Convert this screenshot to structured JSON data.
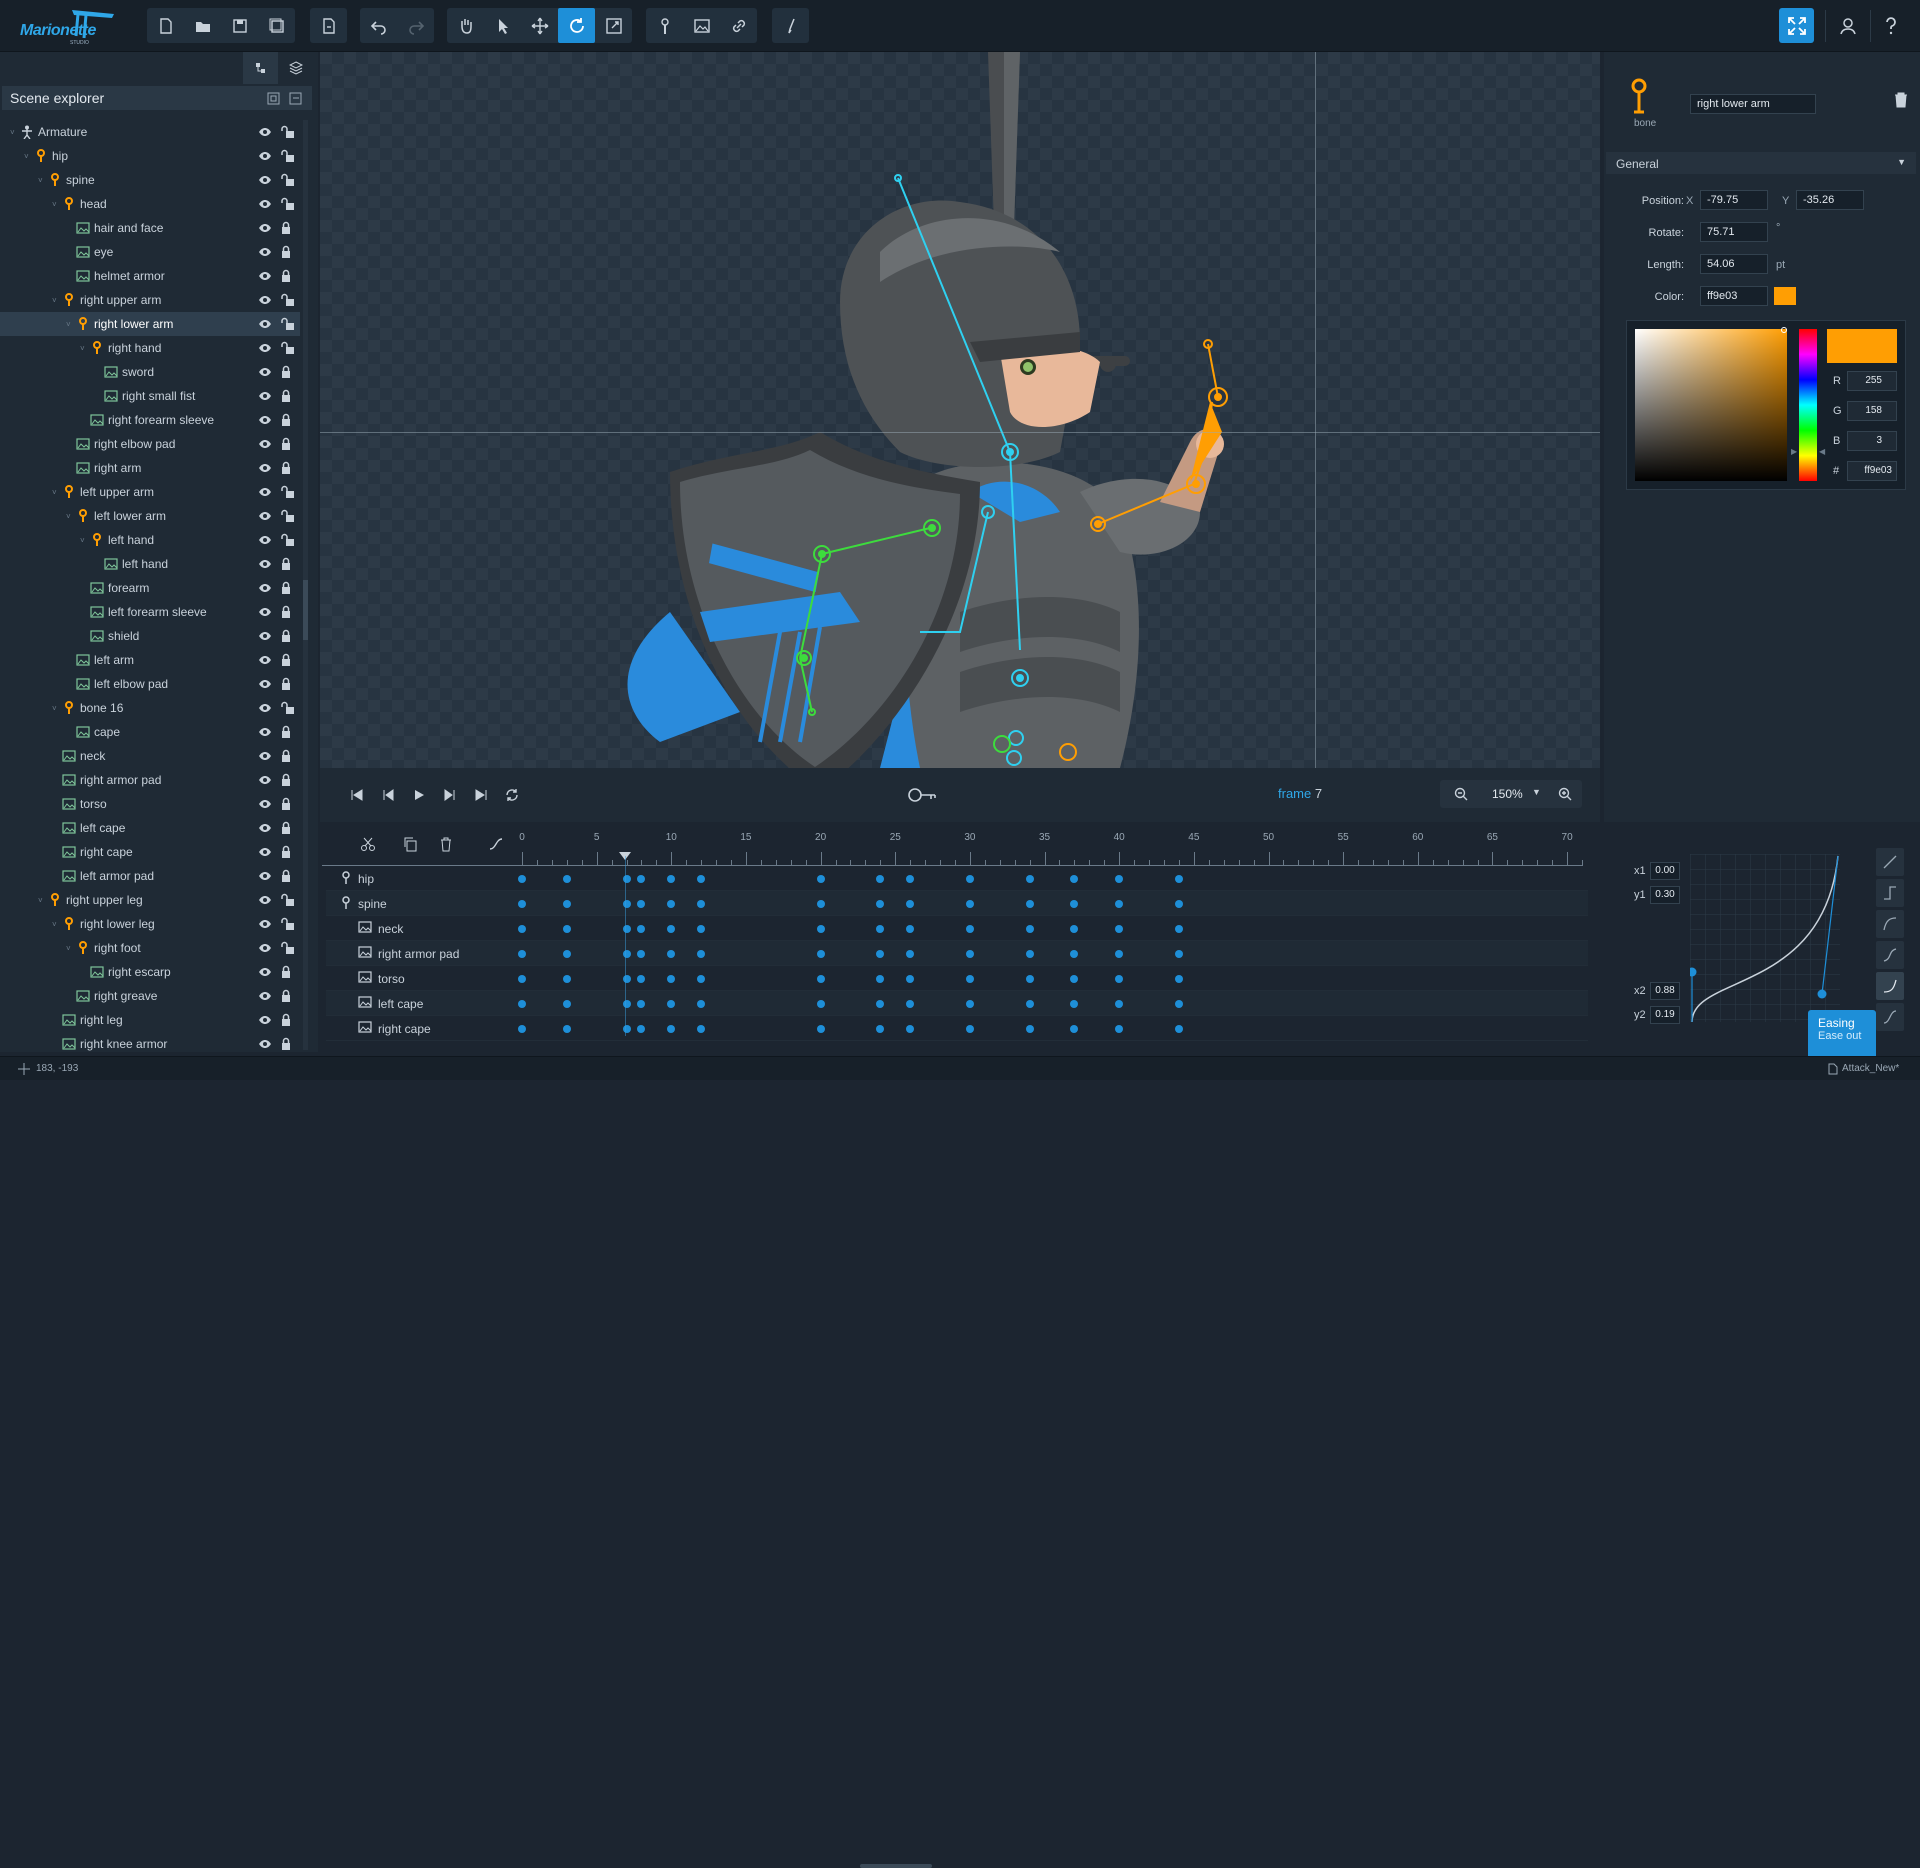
{
  "app": {
    "logo_text": "Marionette",
    "logo_sub": "STUDIO"
  },
  "toolbar": {
    "file_tools": [
      "new-file",
      "open-folder",
      "save",
      "save-all"
    ],
    "export_tool": "export",
    "history_tools": [
      "undo",
      "redo"
    ],
    "transform_tools": [
      "pan-hand",
      "select-arrow",
      "move",
      "rotate",
      "scale"
    ],
    "active_tool": "rotate",
    "create_tools": [
      "add-bone",
      "add-image",
      "link"
    ],
    "extra_tool": "pen"
  },
  "left_panel": {
    "title": "Scene explorer",
    "tree": [
      {
        "label": "Armature",
        "type": "armature",
        "depth": 0,
        "caret": true
      },
      {
        "label": "hip",
        "type": "bone",
        "depth": 1,
        "caret": true
      },
      {
        "label": "spine",
        "type": "bone",
        "depth": 2,
        "caret": true
      },
      {
        "label": "head",
        "type": "bone",
        "depth": 3,
        "caret": true
      },
      {
        "label": "hair and face",
        "type": "image",
        "depth": 4
      },
      {
        "label": "eye",
        "type": "image",
        "depth": 4
      },
      {
        "label": "helmet armor",
        "type": "image",
        "depth": 4
      },
      {
        "label": "right upper arm",
        "type": "bone",
        "depth": 3,
        "caret": true
      },
      {
        "label": "right lower arm",
        "type": "bone",
        "depth": 4,
        "caret": true,
        "selected": true
      },
      {
        "label": "right hand",
        "type": "bone",
        "depth": 5,
        "caret": true
      },
      {
        "label": "sword",
        "type": "image",
        "depth": 6
      },
      {
        "label": "right small fist",
        "type": "image",
        "depth": 6
      },
      {
        "label": "right forearm sleeve",
        "type": "image",
        "depth": 5
      },
      {
        "label": "right elbow pad",
        "type": "image",
        "depth": 4
      },
      {
        "label": "right arm",
        "type": "image",
        "depth": 4
      },
      {
        "label": "left upper arm",
        "type": "bone",
        "depth": 3,
        "caret": true
      },
      {
        "label": "left lower arm",
        "type": "bone",
        "depth": 4,
        "caret": true
      },
      {
        "label": "left hand",
        "type": "bone",
        "depth": 5,
        "caret": true
      },
      {
        "label": "left hand",
        "type": "image",
        "depth": 6
      },
      {
        "label": "forearm",
        "type": "image",
        "depth": 5
      },
      {
        "label": "left forearm sleeve",
        "type": "image",
        "depth": 5
      },
      {
        "label": "shield",
        "type": "image",
        "depth": 5
      },
      {
        "label": "left arm",
        "type": "image",
        "depth": 4
      },
      {
        "label": "left elbow pad",
        "type": "image",
        "depth": 4
      },
      {
        "label": "bone 16",
        "type": "bone",
        "depth": 3,
        "caret": true
      },
      {
        "label": "cape",
        "type": "image",
        "depth": 4
      },
      {
        "label": "neck",
        "type": "image",
        "depth": 3
      },
      {
        "label": "right armor pad",
        "type": "image",
        "depth": 3
      },
      {
        "label": "torso",
        "type": "image",
        "depth": 3
      },
      {
        "label": "left cape",
        "type": "image",
        "depth": 3
      },
      {
        "label": "right cape",
        "type": "image",
        "depth": 3
      },
      {
        "label": "left armor pad",
        "type": "image",
        "depth": 3
      },
      {
        "label": "right upper leg",
        "type": "bone",
        "depth": 2,
        "caret": true
      },
      {
        "label": "right lower leg",
        "type": "bone",
        "depth": 3,
        "caret": true
      },
      {
        "label": "right foot",
        "type": "bone",
        "depth": 4,
        "caret": true
      },
      {
        "label": "right escarp",
        "type": "image",
        "depth": 5
      },
      {
        "label": "right greave",
        "type": "image",
        "depth": 4
      },
      {
        "label": "right leg",
        "type": "image",
        "depth": 3
      },
      {
        "label": "right knee armor",
        "type": "image",
        "depth": 3
      }
    ]
  },
  "playback": {
    "frame_label": "frame",
    "frame_number": "7",
    "zoom": "150%"
  },
  "timeline": {
    "ticks": [
      0,
      5,
      10,
      15,
      20,
      25,
      30,
      35,
      40,
      45,
      50,
      55,
      60,
      65,
      70
    ],
    "current_frame": 7,
    "keyframes": [
      0,
      3,
      7,
      8,
      10,
      12,
      20,
      24,
      26,
      30,
      34,
      37,
      40,
      44
    ],
    "rows": [
      {
        "label": "hip",
        "type": "bone"
      },
      {
        "label": "spine",
        "type": "bone"
      },
      {
        "label": "neck",
        "type": "image"
      },
      {
        "label": "right armor pad",
        "type": "image"
      },
      {
        "label": "torso",
        "type": "image"
      },
      {
        "label": "left cape",
        "type": "image"
      },
      {
        "label": "right cape",
        "type": "image"
      }
    ]
  },
  "properties": {
    "bone_caption": "bone",
    "name": "right lower arm",
    "section": "General",
    "position_label": "Position:",
    "x_label": "X",
    "x_value": "-79.75",
    "y_label": "Y",
    "y_value": "-35.26",
    "rotate_label": "Rotate:",
    "rotate_value": "75.71",
    "rotate_unit": "°",
    "length_label": "Length:",
    "length_value": "54.06",
    "length_unit": "pt",
    "color_label": "Color:",
    "color_value": "ff9e03",
    "color_hex": "#ff9e03"
  },
  "color_picker": {
    "r_label": "R",
    "r_value": "255",
    "g_label": "G",
    "g_value": "158",
    "b_label": "B",
    "b_value": "3",
    "hex_label": "#",
    "hex_value": "ff9e03"
  },
  "easing": {
    "x1_label": "x1",
    "x1": "0.00",
    "y1_label": "y1",
    "y1": "0.30",
    "x2_label": "x2",
    "x2": "0.88",
    "y2_label": "y2",
    "y2": "0.19",
    "tooltip_title": "Easing",
    "tooltip_sub": "Ease out"
  },
  "status": {
    "coords": "183, -193",
    "file": "Attack_New*"
  },
  "colors": {
    "accent": "#1e8fd8",
    "bone_orange": "#ff9e03",
    "bone_green": "#3ddc3d",
    "bone_cyan": "#2fd0f0"
  }
}
